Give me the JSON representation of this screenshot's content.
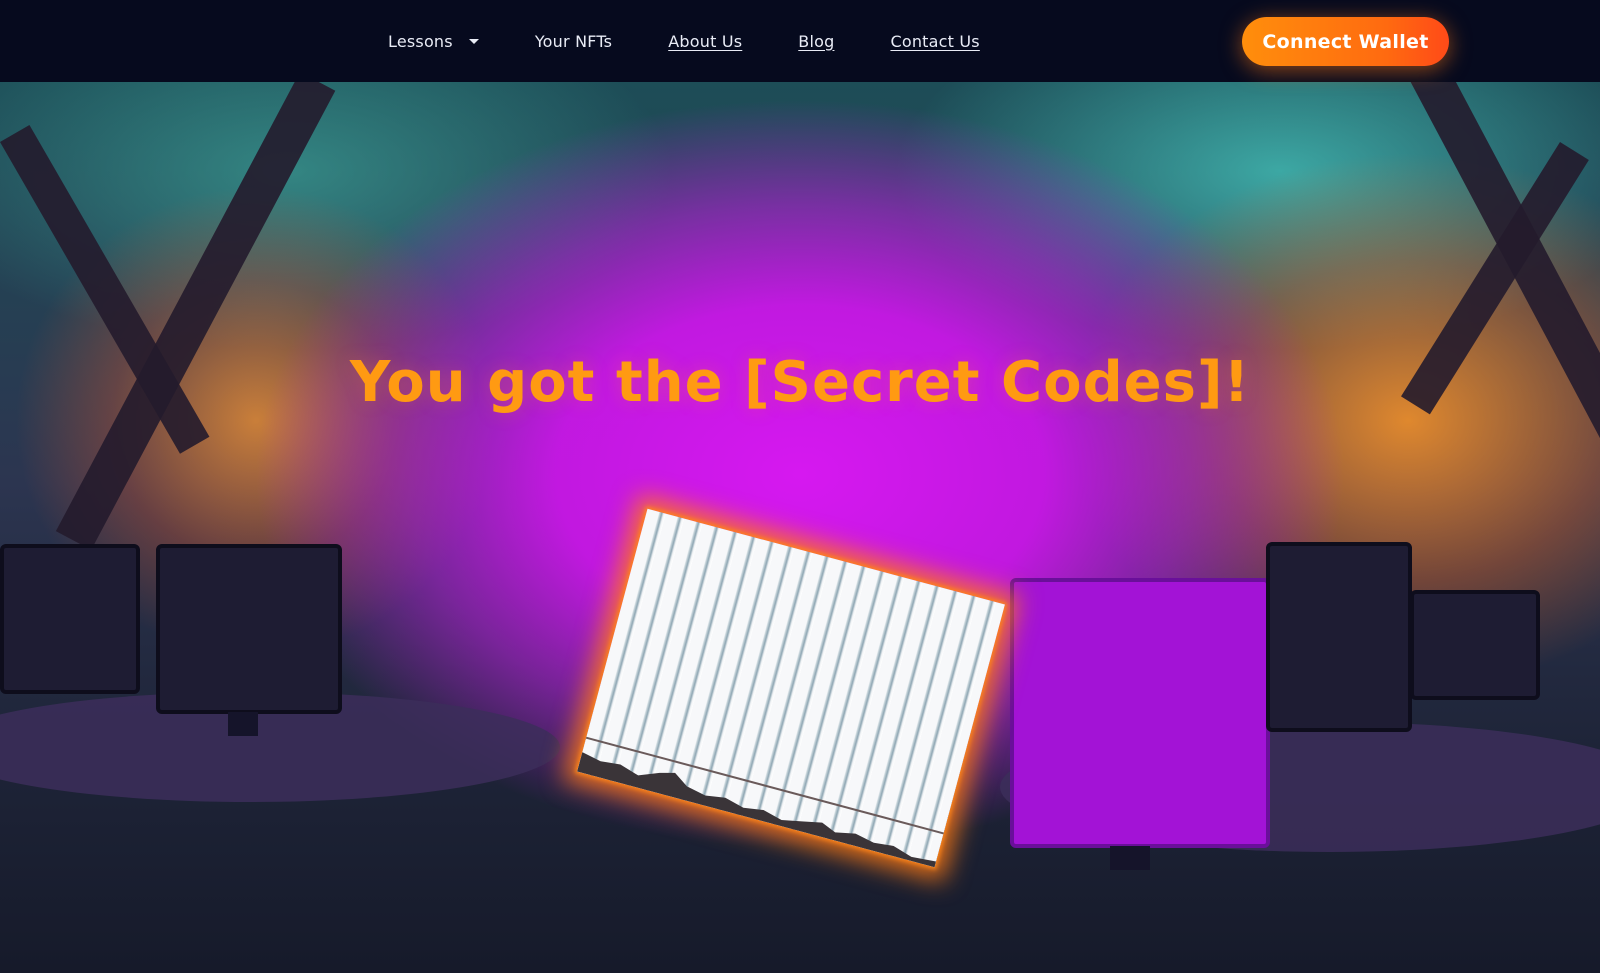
{
  "nav": {
    "items": [
      {
        "label": "Lessons",
        "has_dropdown": true,
        "underlined": false
      },
      {
        "label": "Your NFTs",
        "has_dropdown": false,
        "underlined": false
      },
      {
        "label": "About Us",
        "has_dropdown": false,
        "underlined": true
      },
      {
        "label": "Blog",
        "has_dropdown": false,
        "underlined": true
      },
      {
        "label": "Contact Us",
        "has_dropdown": false,
        "underlined": true
      }
    ],
    "connect_button": "Connect Wallet"
  },
  "hero": {
    "title": "You got the [Secret Codes]!"
  },
  "colors": {
    "navbar_bg": "#060a1e",
    "accent_orange": "#ff8e0c",
    "title_orange": "#ff9a12",
    "magenta_glow": "#d618f0"
  },
  "icons": {
    "dropdown": "caret-down-icon"
  }
}
